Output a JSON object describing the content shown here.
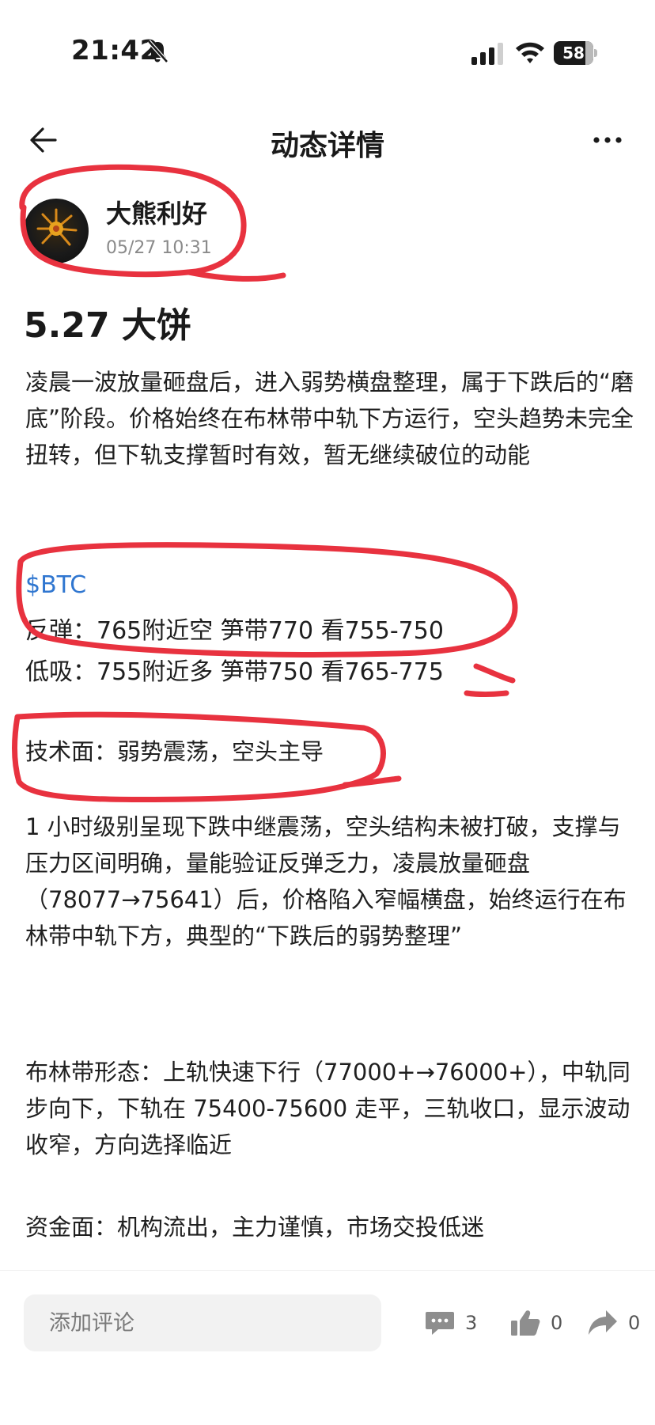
{
  "status_bar": {
    "time": "21:42",
    "battery": "58"
  },
  "nav": {
    "title": "动态详情"
  },
  "author": {
    "name": "大熊利好",
    "time": "05/27 10:31"
  },
  "post": {
    "title": "5.27 大饼",
    "intro": "凌晨一波放量砸盘后，进入弱势横盘整理，属于下跌后的“磨底”阶段。价格始终在布林带中轨下方运行，空头趋势未完全扭转，但下轨支撑暂时有效，暂无继续破位的动能",
    "ticker": "$BTC",
    "signal_rebound": "反弹：765附近空  笋带770  看755-750",
    "signal_dip": "低吸：755附近多  笋带750  看765-775",
    "tech_heading": "技术面：弱势震荡，空头主导",
    "tech_body": "1 小时级别呈现下跌中继震荡，空头结构未被打破，支撑与压力区间明确，量能验证反弹乏力，凌晨放量砸盘（78077→75641）后，价格陷入窄幅横盘，始终运行在布林带中轨下方，典型的“下跌后的弱势整理”",
    "bollinger": "布林带形态：上轨快速下行（77000+→76000+），中轨同步向下，下轨在 75400-75600 走平，三轨收口，显示波动收窄，方向选择临近",
    "funds": "资金面：机构流出，主力谨慎，市场交投低迷"
  },
  "bottom_bar": {
    "comment_placeholder": "添加评论",
    "comment_count": "3",
    "like_count": "0",
    "share_count": "0"
  },
  "colors": {
    "link": "#2f76d0",
    "annotation": "#e8323f"
  }
}
